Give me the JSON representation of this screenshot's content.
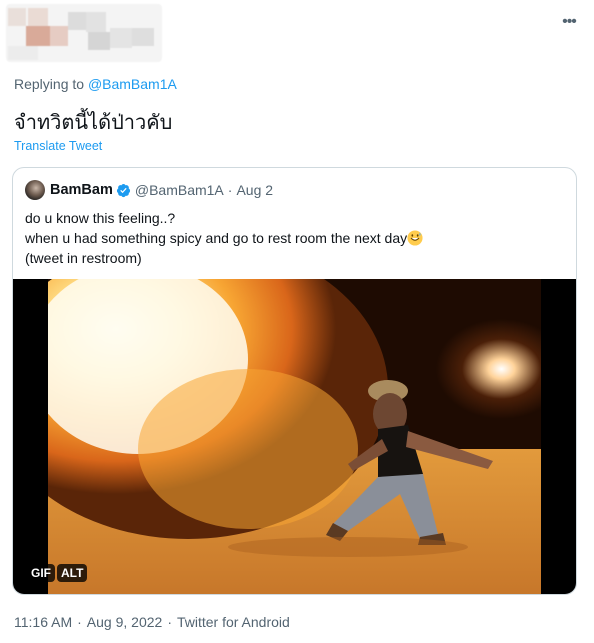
{
  "author": {
    "avatar_redacted": true,
    "more_icon": "more-horizontal-icon"
  },
  "reply": {
    "prefix": "Replying to",
    "handle": "@BamBam1A"
  },
  "tweet": {
    "text": "จำทวิตนี้ได้ป่าวคับ",
    "translate_label": "Translate Tweet"
  },
  "quoted": {
    "name": "BamBam",
    "verified_icon": "verified-badge-icon",
    "handle": "@BamBam1A",
    "dot": "·",
    "date": "Aug 2",
    "lines": [
      "do u know this feeling..?",
      "when u had something spicy and go to rest room the next day",
      "(tweet in restroom)"
    ],
    "emoji_icon": "sweat-smile-emoji-icon",
    "media": {
      "description_icon": "gif-fire-breathing-image",
      "gif_label": "GIF",
      "alt_label": "ALT"
    }
  },
  "meta": {
    "time": "11:16 AM",
    "dot": "·",
    "date": "Aug 9, 2022",
    "dot2": "·",
    "source": "Twitter for Android"
  },
  "colors": {
    "accent": "#1d9bf0",
    "secondary_text": "#536471",
    "border": "#cfd9de"
  }
}
